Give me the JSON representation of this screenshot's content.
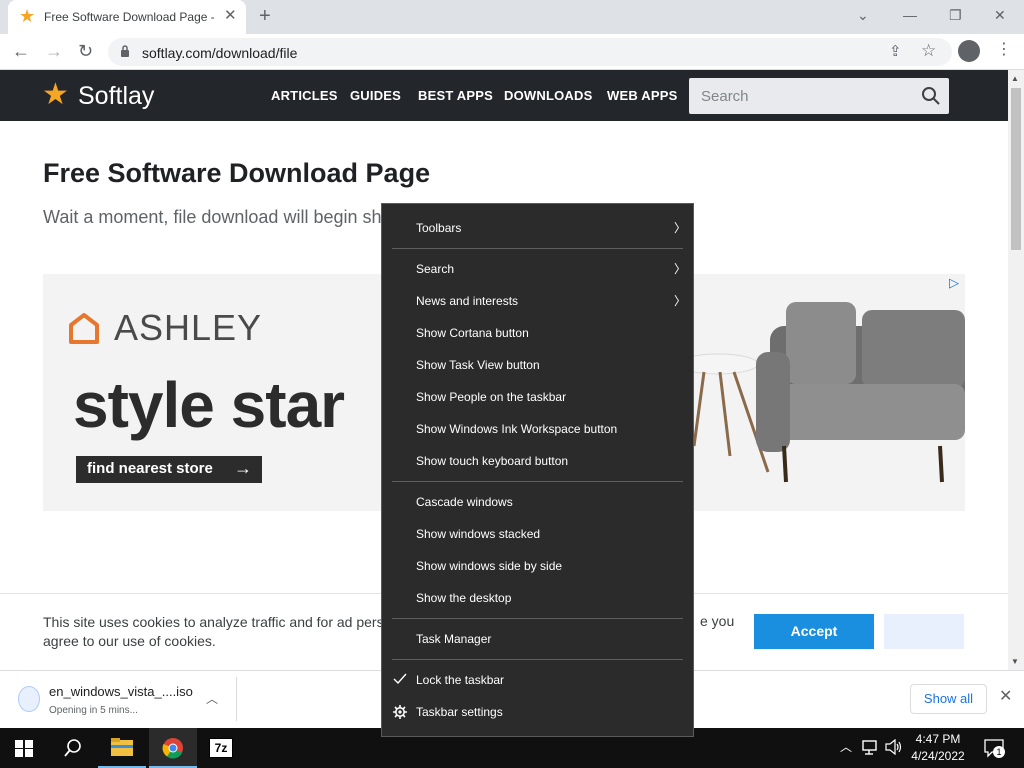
{
  "browser": {
    "tab_title": "Free Software Download Page - Softlay",
    "url": "softlay.com/download/file"
  },
  "site": {
    "logo": "Softlay",
    "nav": [
      "ARTICLES",
      "GUIDES",
      "BEST APPS",
      "DOWNLOADS",
      "WEB APPS"
    ],
    "search_placeholder": "Search",
    "page_title": "Free Software Download Page",
    "subtitle": "Wait a moment, file download will begin sh"
  },
  "ad": {
    "brand": "ASHLEY",
    "slogan": "style star",
    "cta": "find nearest store"
  },
  "cookie": {
    "text": "This site uses cookies to analyze traffic and for ad perso",
    "text_tail": "e you",
    "text2": "agree to our use of cookies.",
    "accept": "Accept"
  },
  "download": {
    "filename": "en_windows_vista_....iso",
    "status": "Opening in 5 mins...",
    "show_all": "Show all"
  },
  "taskbar": {
    "time": "4:47 PM",
    "date": "4/24/2022",
    "notifications": "1"
  },
  "context_menu": {
    "toolbars": "Toolbars",
    "search": "Search",
    "news": "News and interests",
    "cortana": "Show Cortana button",
    "taskview": "Show Task View button",
    "people": "Show People on the taskbar",
    "ink": "Show Windows Ink Workspace button",
    "touch": "Show touch keyboard button",
    "cascade": "Cascade windows",
    "stacked": "Show windows stacked",
    "sidebyside": "Show windows side by side",
    "desktop": "Show the desktop",
    "taskmgr": "Task Manager",
    "lock": "Lock the taskbar",
    "settings": "Taskbar settings"
  },
  "colors": {
    "site_header": "#23262b",
    "accent_star": "#f6a623",
    "accept_button": "#1a8fe0",
    "menu_bg": "#2b2b2b",
    "taskbar_bg": "#101010"
  },
  "icons": [
    "star-icon",
    "close-icon",
    "plus-icon",
    "back-icon",
    "forward-icon",
    "reload-icon",
    "lock-icon",
    "share-icon",
    "bookmark-star-icon",
    "profile-icon",
    "kebab-icon",
    "search-icon",
    "chevron-right-icon",
    "checkmark-icon",
    "gear-icon",
    "windows-start-icon",
    "file-explorer-icon",
    "chrome-icon",
    "7zip-icon",
    "network-icon",
    "volume-icon",
    "notification-icon"
  ]
}
